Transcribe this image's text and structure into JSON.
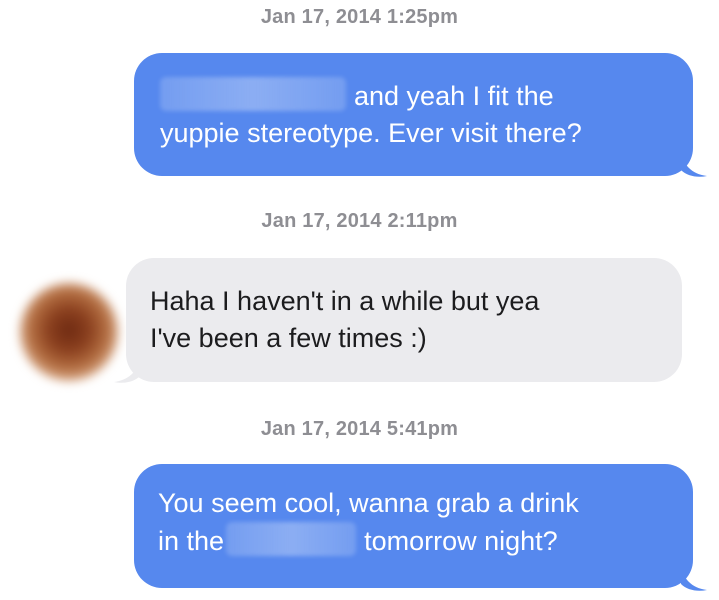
{
  "conversation": {
    "messages": [
      {
        "timestamp": "Jan 17, 2014 1:25pm",
        "direction": "sent",
        "lines": [
          "and yeah I fit the",
          "yuppie stereotype. Ever visit there?"
        ],
        "redacted": true
      },
      {
        "timestamp": "Jan 17, 2014 2:11pm",
        "direction": "received",
        "lines": [
          "Haha I haven't in a while but yea",
          "I've been a few times :)"
        ],
        "avatar": "blurred-profile-photo"
      },
      {
        "timestamp": "Jan 17, 2014 5:41pm",
        "direction": "sent",
        "lines": [
          "You seem cool, wanna grab a drink",
          "in the",
          "tomorrow night?"
        ],
        "redacted": true
      }
    ]
  },
  "colors": {
    "sent_bubble": "#5688ee",
    "received_bubble": "#ebebee",
    "timestamp_text": "#8e8e93"
  }
}
